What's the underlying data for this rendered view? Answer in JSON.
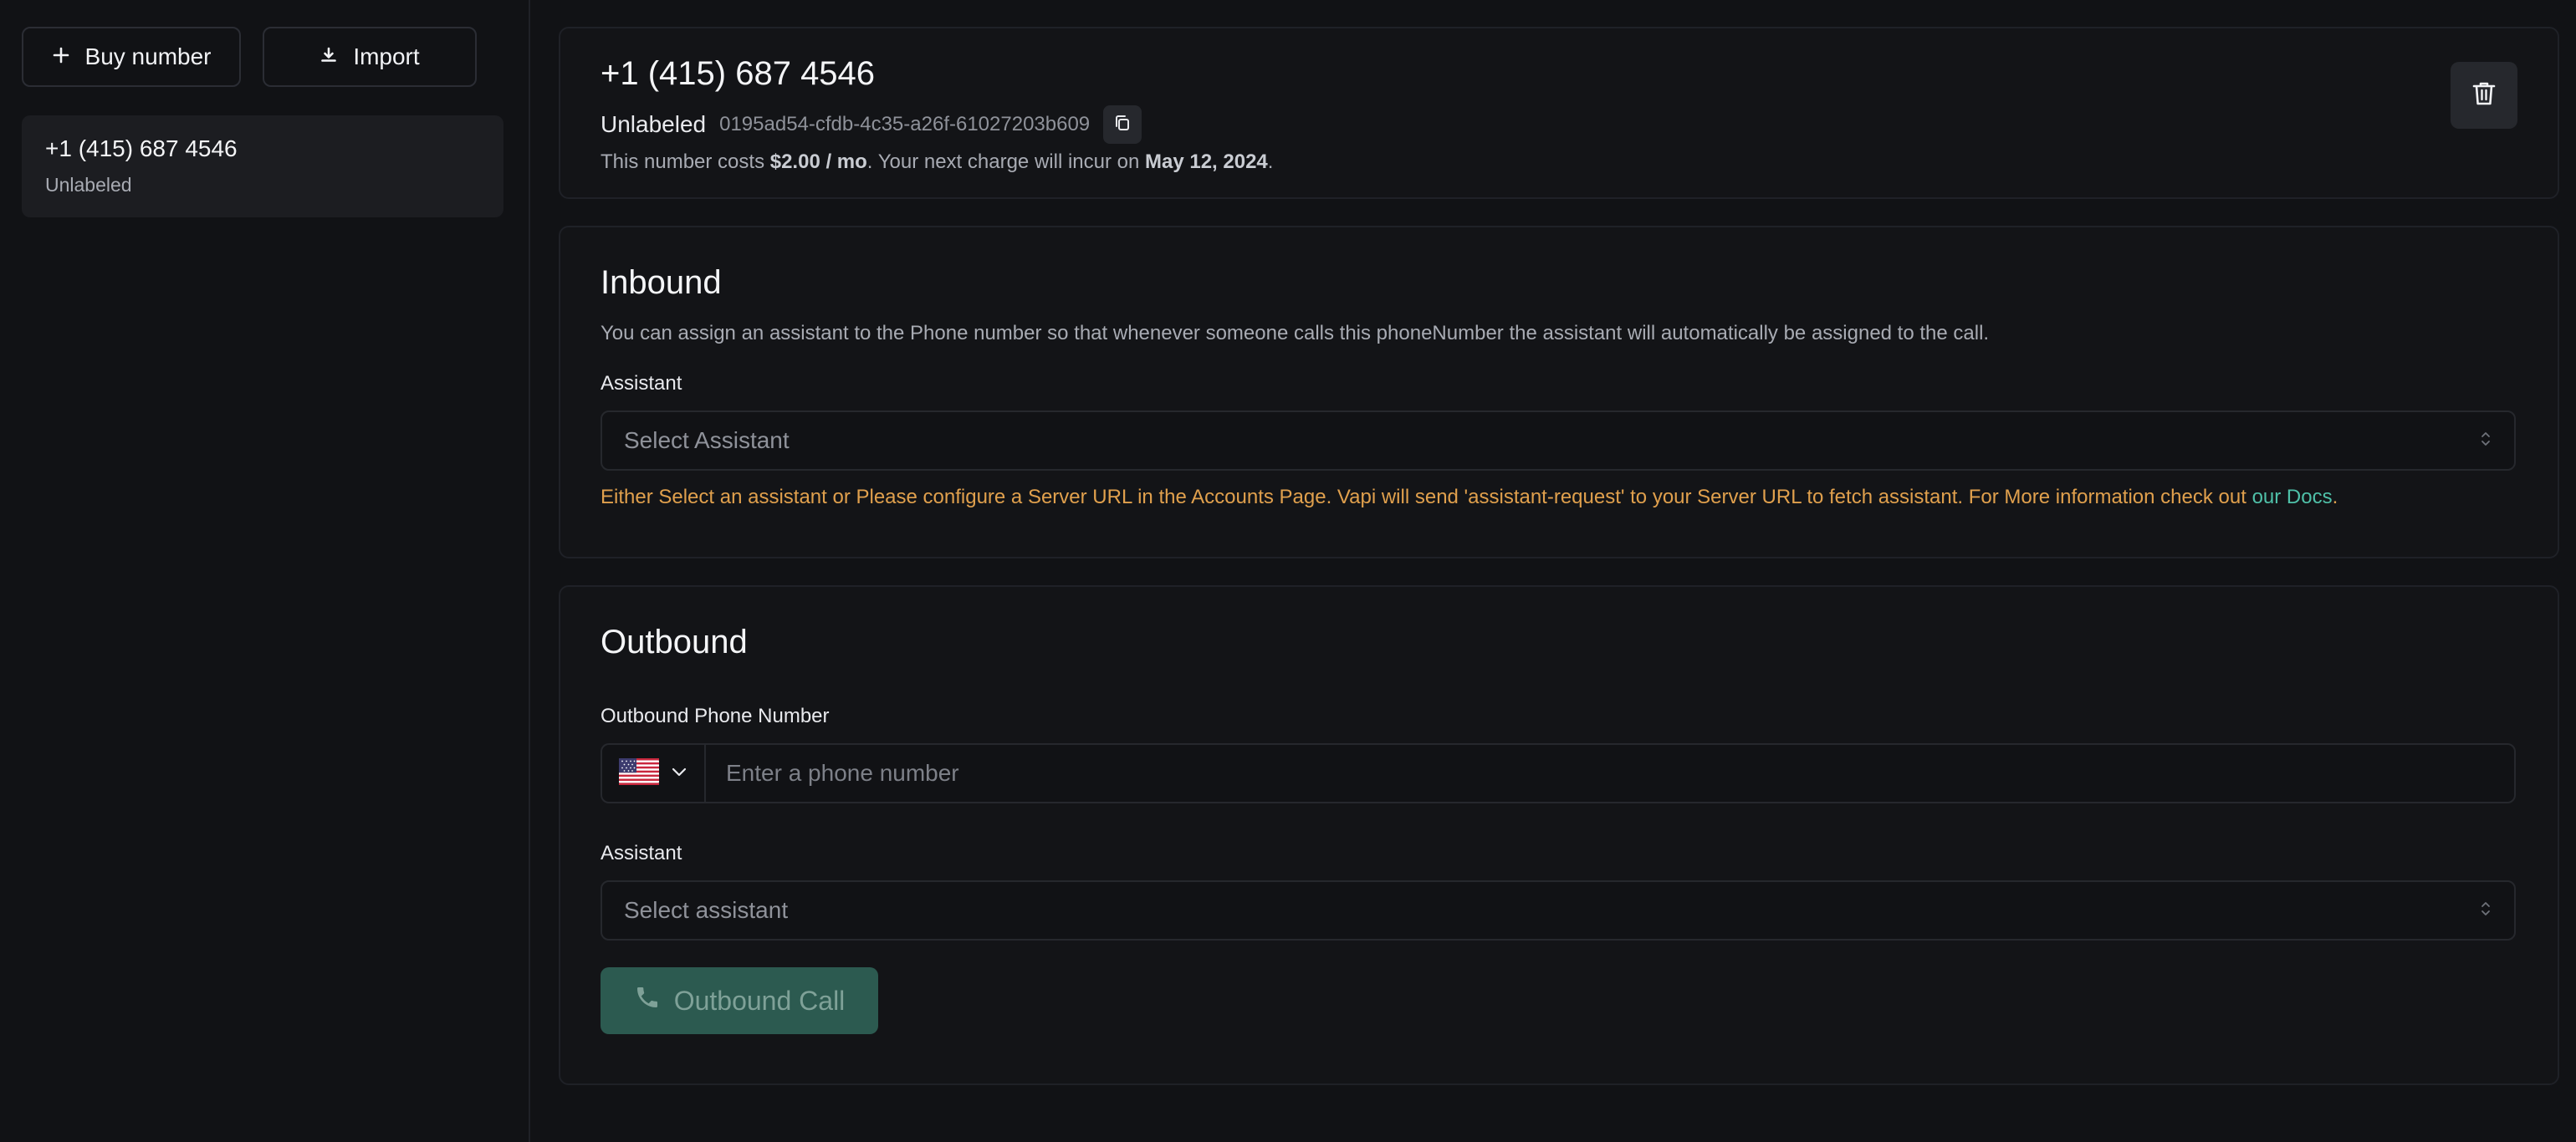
{
  "sidebar": {
    "buy_label": "Buy number",
    "import_label": "Import",
    "numbers": [
      {
        "number": "+1 (415) 687 4546",
        "label": "Unlabeled"
      }
    ]
  },
  "header": {
    "number": "+1 (415) 687 4546",
    "label": "Unlabeled",
    "id": "0195ad54-cfdb-4c35-a26f-61027203b609",
    "cost_prefix": "This number costs ",
    "cost": "$2.00 / mo",
    "cost_middle": ". Your next charge will incur on ",
    "next_charge": "May 12, 2024",
    "cost_suffix": "."
  },
  "inbound": {
    "title": "Inbound",
    "description": "You can assign an assistant to the Phone number so that whenever someone calls this phoneNumber the assistant will automatically be assigned to the call.",
    "assistant_label": "Assistant",
    "assistant_placeholder": "Select Assistant",
    "warning": "Either Select an assistant or Please configure a Server URL in the Accounts Page. Vapi will send 'assistant-request' to your Server URL to fetch assistant. For More information check out ",
    "docs_link": "our Docs",
    "warning_end": "."
  },
  "outbound": {
    "title": "Outbound",
    "phone_label": "Outbound Phone Number",
    "phone_placeholder": "Enter a phone number",
    "country_icon": "us-flag-icon",
    "assistant_label": "Assistant",
    "assistant_placeholder": "Select assistant",
    "call_label": "Outbound Call"
  },
  "colors": {
    "background": "#111215",
    "card": "#131417",
    "warning": "#e0a04d",
    "link": "#4fc0a8",
    "call_button": "#2c5a50"
  }
}
